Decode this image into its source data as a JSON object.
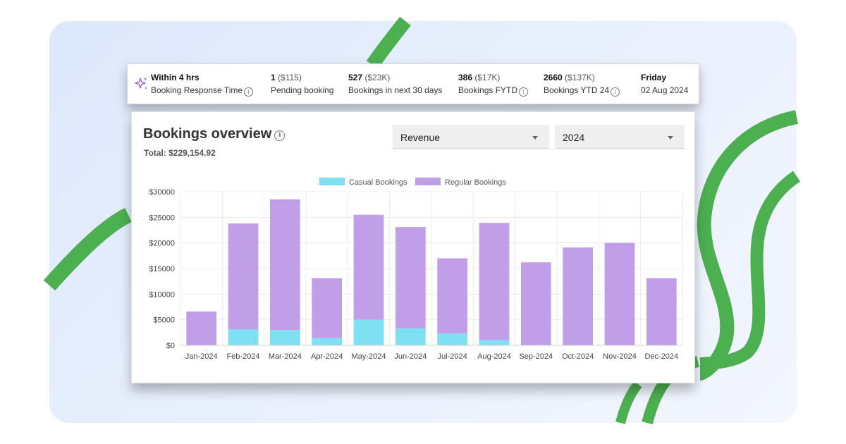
{
  "stats": [
    {
      "value": "Within 4 hrs",
      "sub": "",
      "label": "Booking Response Time",
      "info": true
    },
    {
      "value": "1",
      "sub": " ($115)",
      "label": "Pending booking",
      "info": false
    },
    {
      "value": "527",
      "sub": " ($23K)",
      "label": "Bookings in next 30 days",
      "info": false
    },
    {
      "value": "386",
      "sub": " ($17K)",
      "label": "Bookings FYTD",
      "info": true
    },
    {
      "value": "2660",
      "sub": " ($137K)",
      "label": "Bookings YTD 24",
      "info": true
    },
    {
      "value": "Friday",
      "sub": "",
      "label": "02 Aug 2024",
      "info": false
    }
  ],
  "overview": {
    "title": "Bookings overview",
    "total": "Total: $229,154.92",
    "metric_select": "Revenue",
    "year_select": "2024"
  },
  "colors": {
    "casual": "#7fe0f4",
    "regular": "#c09fe8",
    "swoosh": "#4caf50"
  },
  "chart_data": {
    "type": "bar",
    "stacked": true,
    "categories": [
      "Jan-2024",
      "Feb-2024",
      "Mar-2024",
      "Apr-2024",
      "May-2024",
      "Jun-2024",
      "Jul-2024",
      "Aug-2024",
      "Sep-2024",
      "Oct-2024",
      "Nov-2024",
      "Dec-2024"
    ],
    "series": [
      {
        "name": "Casual Bookings",
        "values": [
          0,
          3100,
          3000,
          1400,
          5000,
          3300,
          2300,
          1000,
          0,
          0,
          0,
          0
        ]
      },
      {
        "name": "Regular Bookings",
        "values": [
          6600,
          20700,
          25500,
          11700,
          20500,
          19800,
          14700,
          22900,
          16200,
          19100,
          20000,
          13100
        ]
      }
    ],
    "yticks": [
      "$30000",
      "$25000",
      "$20000",
      "$15000",
      "$10000",
      "$5000",
      "$0"
    ],
    "ylim": [
      0,
      30000
    ],
    "legend": "top",
    "grid": true
  }
}
